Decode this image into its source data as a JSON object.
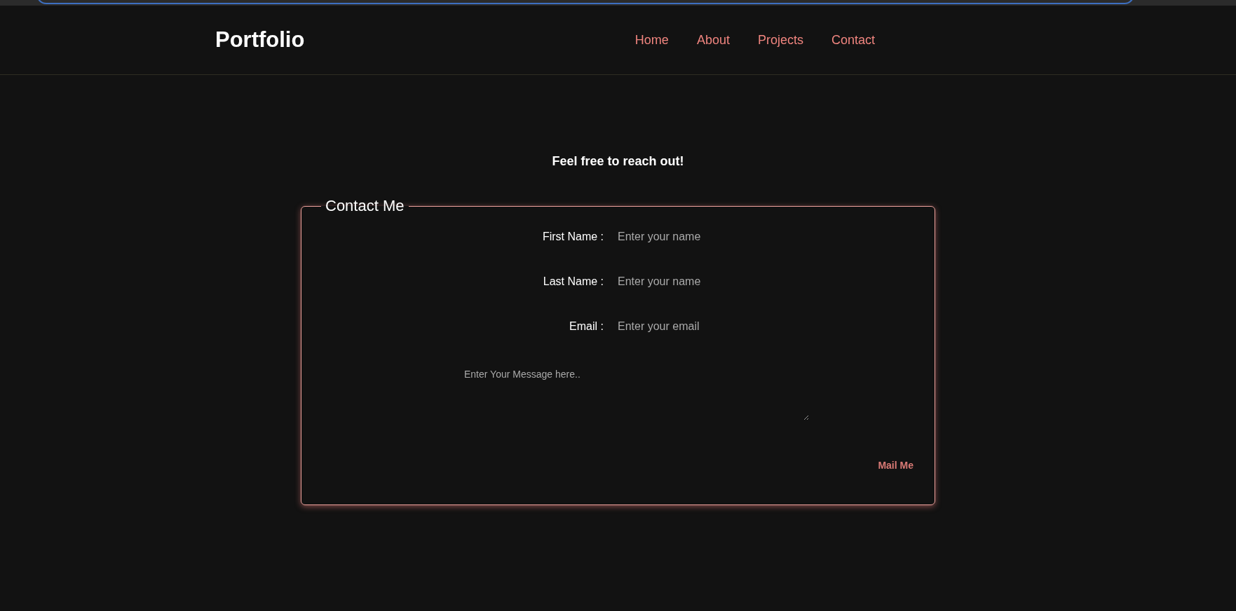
{
  "header": {
    "logo": "Portfolio",
    "nav": [
      {
        "label": "Home"
      },
      {
        "label": "About"
      },
      {
        "label": "Projects"
      },
      {
        "label": "Contact"
      }
    ]
  },
  "intro": "Feel free to reach out!",
  "form": {
    "legend": "Contact Me",
    "fields": [
      {
        "label": "First Name :",
        "placeholder": "Enter your name"
      },
      {
        "label": "Last Name :",
        "placeholder": "Enter your name"
      },
      {
        "label": "Email :",
        "placeholder": "Enter your email"
      }
    ],
    "message": {
      "placeholder": "Enter Your Message here.."
    },
    "submit": "Mail Me"
  }
}
